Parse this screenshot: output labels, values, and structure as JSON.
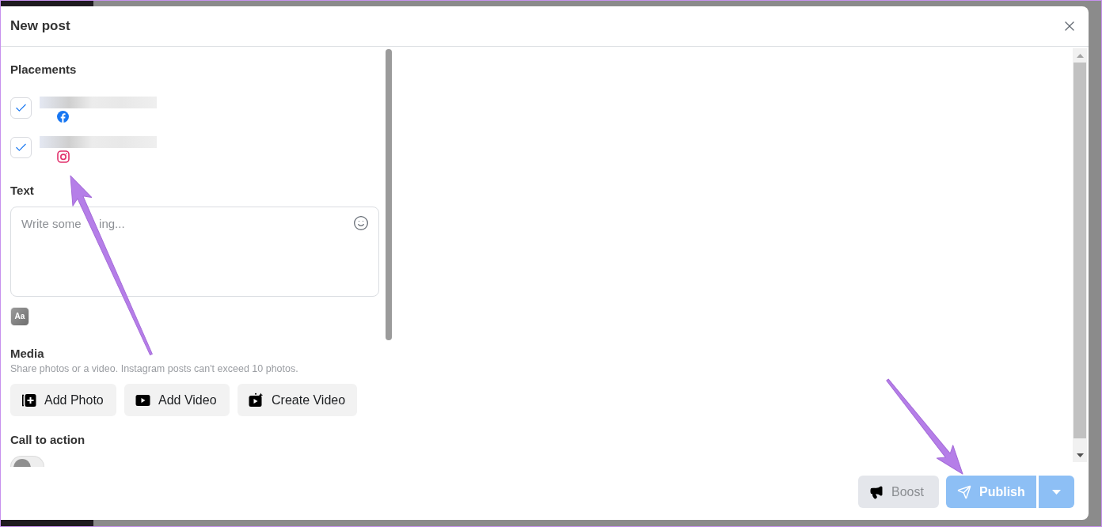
{
  "dialog": {
    "title": "New post"
  },
  "placements": {
    "heading": "Placements",
    "accounts": [
      {
        "kind": "facebook",
        "checked": true
      },
      {
        "kind": "instagram",
        "checked": true
      }
    ]
  },
  "text": {
    "heading": "Text",
    "placeholder": [
      "Write some",
      "ing..."
    ],
    "format_button": "Aa"
  },
  "media": {
    "heading": "Media",
    "note": "Share photos or a video. Instagram posts can't exceed 10 photos.",
    "buttons": [
      {
        "kind": "photo",
        "label": "Add Photo"
      },
      {
        "kind": "video",
        "label": "Add Video"
      },
      {
        "kind": "create",
        "label": "Create Video"
      }
    ]
  },
  "call_to_action": {
    "heading": "Call to action",
    "toggle": {
      "on": false
    }
  },
  "footer": {
    "boost": {
      "label": "Boost",
      "disabled": true
    },
    "publish": {
      "label": "Publish",
      "disabled": true
    },
    "publish_menu": {
      "disabled": true
    }
  }
}
